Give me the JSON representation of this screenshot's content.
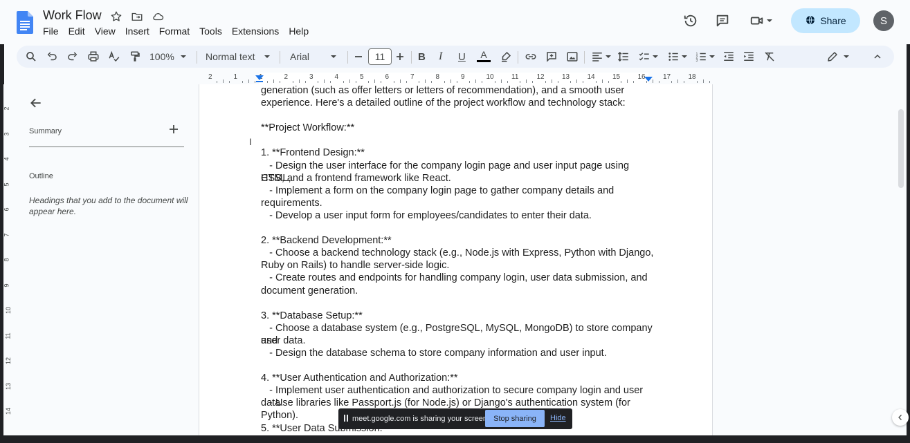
{
  "app": {
    "title": "Work Flow",
    "menu": [
      "File",
      "Edit",
      "View",
      "Insert",
      "Format",
      "Tools",
      "Extensions",
      "Help"
    ],
    "share_label": "Share",
    "avatar_initial": "S"
  },
  "toolbar": {
    "zoom": "100%",
    "style": "Normal text",
    "font": "Arial",
    "font_size": "11"
  },
  "ruler": {
    "numbers": [
      "2",
      "1",
      "1",
      "2",
      "3",
      "4",
      "5",
      "6",
      "7",
      "8",
      "9",
      "10",
      "11",
      "12",
      "13",
      "14",
      "15",
      "16",
      "17",
      "18"
    ],
    "vertical": [
      "2",
      "3",
      "4",
      "5",
      "6",
      "7",
      "8",
      "9",
      "10",
      "11",
      "12",
      "13",
      "14"
    ]
  },
  "sidebar": {
    "summary_label": "Summary",
    "outline_label": "Outline",
    "outline_hint": "Headings that you add to the document will appear here."
  },
  "document": {
    "lines": [
      "generation (such as offer letters or letters of recommendation), and a smooth user",
      "experience. Here's a detailed outline of the project workflow and technology stack:",
      "",
      "**Project Workflow:**",
      "",
      "1. **Frontend Design:**",
      "   - Design the user interface for the company login page and user input page using HTML,",
      "CSS, and a frontend framework like React.",
      "   - Implement a form on the company login page to gather company details and",
      "requirements.",
      "   - Develop a user input form for employees/candidates to enter their data.",
      "",
      "2. **Backend Development:**",
      "   - Choose a backend technology stack (e.g., Node.js with Express, Python with Django,",
      "Ruby on Rails) to handle server-side logic.",
      "   - Create routes and endpoints for handling company login, user data submission, and",
      "document generation.",
      "",
      "3. **Database Setup:**",
      "   - Choose a database system (e.g., PostgreSQL, MySQL, MongoDB) to store company and",
      "user data.",
      "   - Design the database schema to store company information and user input.",
      "",
      "4. **User Authentication and Authorization:**",
      "   - Implement user authentication and authorization to secure company login and user data.",
      "   - Use libraries like Passport.js (for Node.js) or Django's authentication system (for Python).",
      "",
      "5. **User Data Submission:**"
    ]
  },
  "screen_share": {
    "message": "meet.google.com is sharing your screen.",
    "stop_label": "Stop sharing",
    "hide_label": "Hide"
  },
  "colors": {
    "accent": "#1a73e8",
    "share_bg": "#c2e7ff",
    "toolbar_bg": "#edf2fa",
    "page_bg": "#ffffff"
  }
}
